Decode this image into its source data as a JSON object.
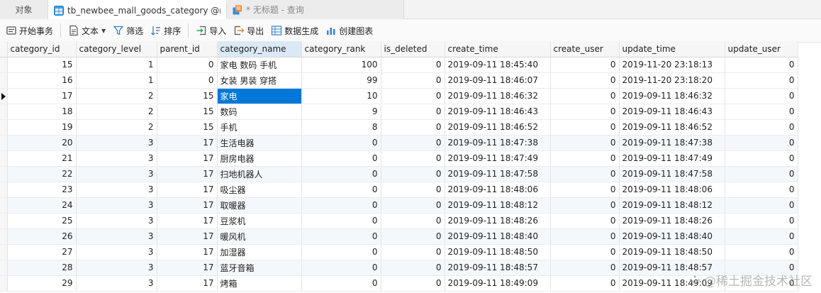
{
  "tabs": [
    {
      "label": "对象",
      "icon": "none"
    },
    {
      "label": "tb_newbee_mall_goods_category @n...",
      "icon": "table-icon"
    },
    {
      "label": "* 无标题 - 查询",
      "icon": "query-icon"
    }
  ],
  "toolbar": {
    "begin_transaction": "开始事务",
    "text": "文本",
    "filter": "筛选",
    "sort": "排序",
    "import": "导入",
    "export": "导出",
    "data_generation": "数据生成",
    "create_chart": "创建图表"
  },
  "grid": {
    "columns": [
      "category_id",
      "category_level",
      "parent_id",
      "category_name",
      "category_rank",
      "is_deleted",
      "create_time",
      "create_user",
      "update_time",
      "update_user"
    ],
    "sorted_column": "category_name",
    "selected_row": 2,
    "rows": [
      [
        "15",
        "1",
        "0",
        "家电 数码 手机",
        "100",
        "0",
        "2019-09-11 18:45:40",
        "0",
        "2019-11-20 23:18:13",
        "0"
      ],
      [
        "16",
        "1",
        "0",
        "女装 男装 穿搭",
        "99",
        "0",
        "2019-09-11 18:46:07",
        "0",
        "2019-11-20 23:18:20",
        "0"
      ],
      [
        "17",
        "2",
        "15",
        "家电",
        "10",
        "0",
        "2019-09-11 18:46:32",
        "0",
        "2019-09-11 18:46:32",
        "0"
      ],
      [
        "18",
        "2",
        "15",
        "数码",
        "9",
        "0",
        "2019-09-11 18:46:43",
        "0",
        "2019-09-11 18:46:43",
        "0"
      ],
      [
        "19",
        "2",
        "15",
        "手机",
        "8",
        "0",
        "2019-09-11 18:46:52",
        "0",
        "2019-09-11 18:46:52",
        "0"
      ],
      [
        "20",
        "3",
        "17",
        "生活电器",
        "0",
        "0",
        "2019-09-11 18:47:38",
        "0",
        "2019-09-11 18:47:38",
        "0"
      ],
      [
        "21",
        "3",
        "17",
        "厨房电器",
        "0",
        "0",
        "2019-09-11 18:47:49",
        "0",
        "2019-09-11 18:47:49",
        "0"
      ],
      [
        "22",
        "3",
        "17",
        "扫地机器人",
        "0",
        "0",
        "2019-09-11 18:47:58",
        "0",
        "2019-09-11 18:47:58",
        "0"
      ],
      [
        "23",
        "3",
        "17",
        "吸尘器",
        "0",
        "0",
        "2019-09-11 18:48:06",
        "0",
        "2019-09-11 18:48:06",
        "0"
      ],
      [
        "24",
        "3",
        "17",
        "取暖器",
        "0",
        "0",
        "2019-09-11 18:48:12",
        "0",
        "2019-09-11 18:48:12",
        "0"
      ],
      [
        "25",
        "3",
        "17",
        "豆浆机",
        "0",
        "0",
        "2019-09-11 18:48:26",
        "0",
        "2019-09-11 18:48:26",
        "0"
      ],
      [
        "26",
        "3",
        "17",
        "暖风机",
        "0",
        "0",
        "2019-09-11 18:48:40",
        "0",
        "2019-09-11 18:48:40",
        "0"
      ],
      [
        "27",
        "3",
        "17",
        "加湿器",
        "0",
        "0",
        "2019-09-11 18:48:50",
        "0",
        "2019-09-11 18:48:50",
        "0"
      ],
      [
        "28",
        "3",
        "17",
        "蓝牙音箱",
        "0",
        "0",
        "2019-09-11 18:48:57",
        "0",
        "2019-09-11 18:48:57",
        "0"
      ],
      [
        "29",
        "3",
        "17",
        "烤箱",
        "0",
        "0",
        "2019-09-11 18:49:09",
        "0",
        "2019-09-11 18:49:09",
        "0"
      ]
    ]
  },
  "watermark": "@稀土掘金技术社区",
  "colors": {
    "selection": "#0078d7",
    "sorted_header": "#dbe9f6",
    "alt_row": "#f4f8fd"
  }
}
